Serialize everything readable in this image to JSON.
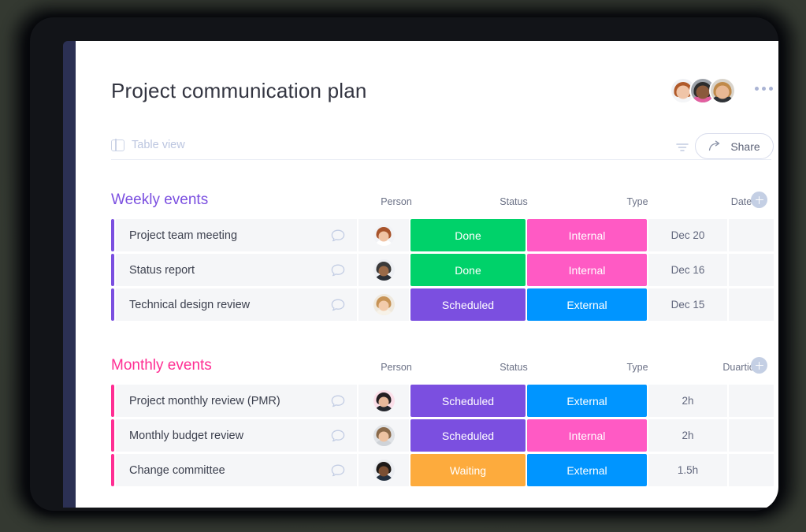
{
  "header": {
    "title": "Project communication plan",
    "view_tab_label": "Table view",
    "share_label": "Share",
    "more_icon": "more-horizontal-icon",
    "filter_icon": "filter-icon",
    "share_icon": "share-arrow-icon",
    "table_icon": "table-view-icon",
    "avatars": [
      {
        "name": "avatar-1",
        "hair": "#b05a2a",
        "skin": "#f0c5a8",
        "body": "#f4f5f7",
        "bg": "#f0f1f4"
      },
      {
        "name": "avatar-2",
        "hair": "#2c2c2c",
        "skin": "#8a5a3c",
        "body": "#e25fa0",
        "bg": "#9ea3aa"
      },
      {
        "name": "avatar-3",
        "hair": "#c08a4a",
        "skin": "#e8b894",
        "body": "#2f3338",
        "bg": "#d9d4cc"
      }
    ]
  },
  "colors": {
    "accent_purple": "#7B4FE0",
    "accent_pink": "#FF2E93",
    "green": "#00D26A",
    "pink": "#FF5AC4",
    "purple": "#7B4FE0",
    "blue": "#0095FF",
    "orange": "#FDAB3D",
    "cell_bg": "#F5F6F8"
  },
  "groups": [
    {
      "title": "Weekly events",
      "title_color": "#7B4FE0",
      "accent_color": "#7B4FE0",
      "columns": [
        "Person",
        "Status",
        "Type",
        "Date"
      ],
      "add_column_label": "+",
      "rows": [
        {
          "name": "Project team meeting",
          "status": "Done",
          "status_color": "#00D26A",
          "type": "Internal",
          "type_color": "#FF5AC4",
          "date": "Dec 20",
          "avatar": {
            "hair": "#a8542b",
            "skin": "#f0c3a4",
            "body": "#ffffff",
            "bg": "#f2f3f6"
          }
        },
        {
          "name": "Status report",
          "status": "Done",
          "status_color": "#00D26A",
          "type": "Internal",
          "type_color": "#FF5AC4",
          "date": "Dec 16",
          "avatar": {
            "hair": "#3a3a3a",
            "skin": "#9a6a48",
            "body": "#2b2f36",
            "bg": "#eef0f4"
          }
        },
        {
          "name": "Technical design review",
          "status": "Scheduled",
          "status_color": "#7B4FE0",
          "type": "External",
          "type_color": "#0095FF",
          "date": "Dec 15",
          "avatar": {
            "hair": "#c79356",
            "skin": "#f2cbab",
            "body": "#f7f2e8",
            "bg": "#efe9de"
          }
        }
      ]
    },
    {
      "title": "Monthly events",
      "title_color": "#FF2E93",
      "accent_color": "#FF2E93",
      "columns": [
        "Person",
        "Status",
        "Type",
        "Duartion"
      ],
      "add_column_label": "+",
      "rows": [
        {
          "name": "Project monthly review (PMR)",
          "status": "Scheduled",
          "status_color": "#7B4FE0",
          "type": "External",
          "type_color": "#0095FF",
          "date": "2h",
          "avatar": {
            "hair": "#241f22",
            "skin": "#e7b89a",
            "body": "#23262c",
            "bg": "#fbdfe9"
          }
        },
        {
          "name": "Monthly budget review",
          "status": "Scheduled",
          "status_color": "#7B4FE0",
          "type": "Internal",
          "type_color": "#FF5AC4",
          "date": "2h",
          "avatar": {
            "hair": "#8a6a4a",
            "skin": "#edc3a2",
            "body": "#cfd3d8",
            "bg": "#dfe2e6"
          }
        },
        {
          "name": "Change committee",
          "status": "Waiting",
          "status_color": "#FDAB3D",
          "type": "External",
          "type_color": "#0095FF",
          "date": "1.5h",
          "avatar": {
            "hair": "#1d1a18",
            "skin": "#7a4f33",
            "body": "#23303f",
            "bg": "#eceef2"
          }
        }
      ]
    }
  ]
}
